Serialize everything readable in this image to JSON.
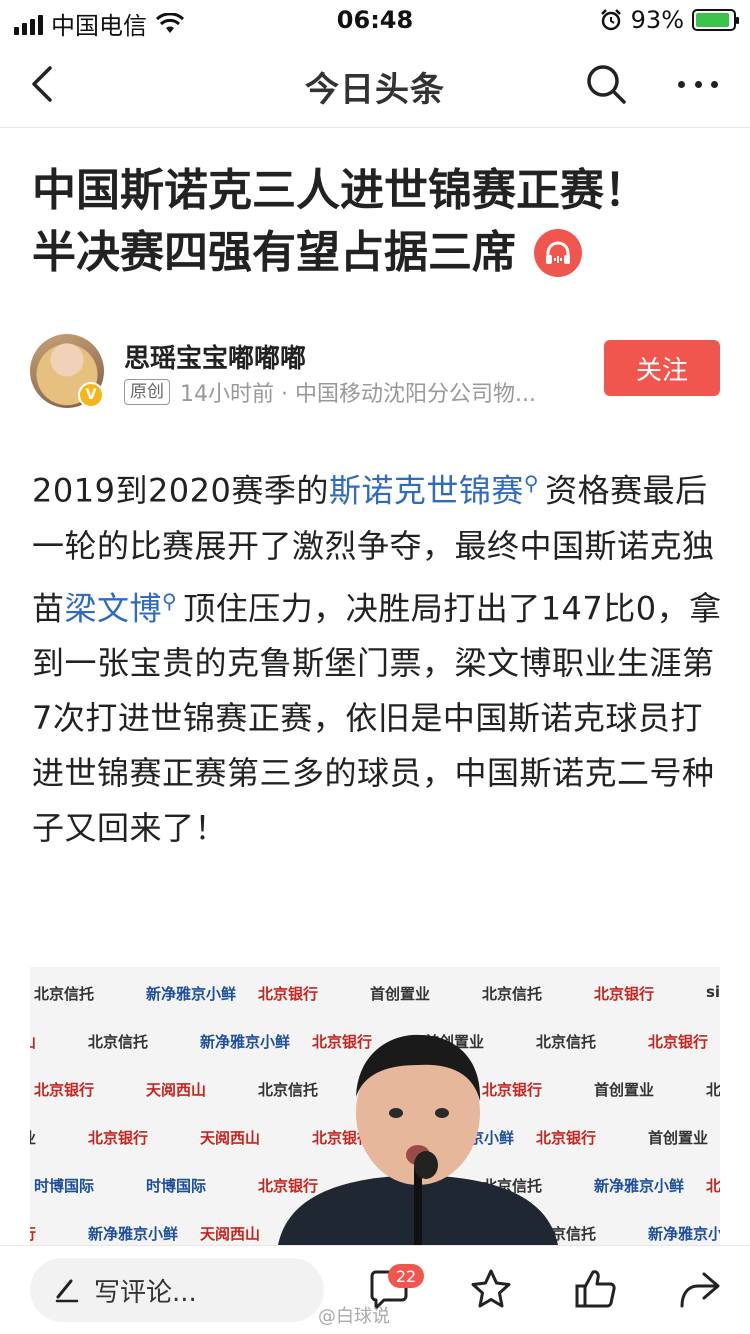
{
  "status_bar": {
    "carrier": "中国电信",
    "time": "06:48",
    "battery": "93%",
    "battery_level": 0.93
  },
  "nav": {
    "title": "今日头条",
    "icons": [
      "back-icon",
      "search-icon",
      "more-icon"
    ]
  },
  "headline": {
    "line1": "中国斯诺克三人进世锦赛正赛！",
    "line2": "半决赛四强有望占据三席"
  },
  "author": {
    "name": "思瑶宝宝嘟嘟嘟",
    "tag": "原创",
    "meta": "14小时前 · 中国移动沈阳分公司物...",
    "follow_label": "关注"
  },
  "article": {
    "p1_a": "2019到2020赛季的",
    "link1": "斯诺克世锦赛",
    "p1_b": "资格赛最后一轮的比赛展开了激烈争夺，最终中国斯诺克独苗",
    "link2": "梁文博",
    "p1_c": "顶住压力，决胜局打出了147比0，拿到一张宝贵的克鲁斯堡门票，梁文博职业生涯第7次打进世锦赛正赛，依旧是中国斯诺克球员打进世锦赛正赛第三多的球员，中国斯诺克二号种子又回来了！"
  },
  "image": {
    "sponsors": {
      "bank": "北京银行",
      "trust": "北京信托",
      "capital": "首创置业",
      "xibei": "新净雅京小鲜",
      "tianyue": "天阅西山",
      "sports": "时博国际",
      "sina": "sina"
    }
  },
  "bottom_bar": {
    "comment_placeholder": "写评论...",
    "comment_count": "22",
    "watermark": "@白球说"
  }
}
